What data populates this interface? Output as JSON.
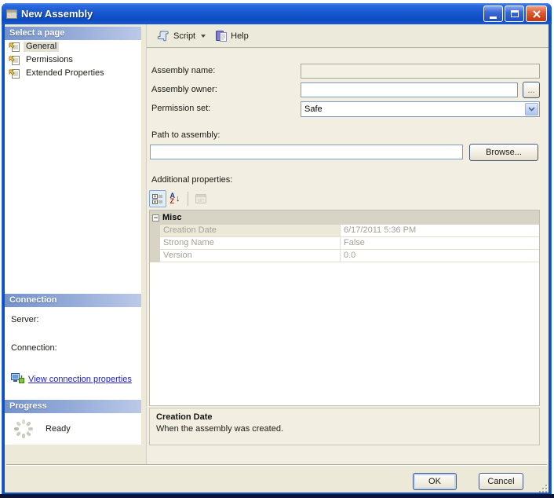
{
  "window": {
    "title": "New Assembly"
  },
  "toolbar": {
    "script_label": "Script",
    "help_label": "Help"
  },
  "sidebar": {
    "pages_header": "Select a page",
    "pages": [
      {
        "label": "General"
      },
      {
        "label": "Permissions"
      },
      {
        "label": "Extended Properties"
      }
    ],
    "connection_header": "Connection",
    "server_label": "Server:",
    "server_value": "",
    "connection_label": "Connection:",
    "connection_value": "",
    "view_connection_link": "View connection properties",
    "progress_header": "Progress",
    "progress_status": "Ready"
  },
  "form": {
    "assembly_name_label": "Assembly name:",
    "assembly_name_value": "",
    "assembly_owner_label": "Assembly owner:",
    "assembly_owner_value": "",
    "owner_browse_label": "...",
    "permission_set_label": "Permission set:",
    "permission_set_value": "Safe",
    "path_label": "Path to assembly:",
    "path_value": "",
    "browse_label": "Browse..."
  },
  "properties": {
    "section_label": "Additional properties:",
    "category_label": "Misc",
    "expander_glyph": "−",
    "rows": [
      {
        "name": "Creation Date",
        "value": "6/17/2011 5:36 PM"
      },
      {
        "name": "Strong Name",
        "value": "False"
      },
      {
        "name": "Version",
        "value": "0.0"
      }
    ],
    "description_title": "Creation Date",
    "description_text": "When the assembly was created."
  },
  "icons": {
    "sort_a": "A",
    "sort_z": "Z",
    "sort_arrow": "↓"
  },
  "footer": {
    "ok_label": "OK",
    "cancel_label": "Cancel"
  },
  "colors": {
    "titlebar_blue": "#1254cb",
    "panel_header_blue": "#7493cb",
    "selection_beige": "#e3e0d3",
    "link_blue": "#2121c8",
    "close_red": "#c63c14"
  }
}
